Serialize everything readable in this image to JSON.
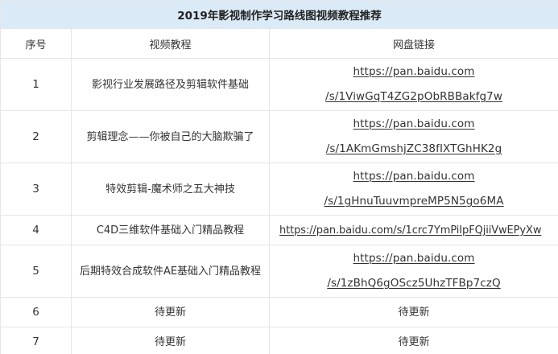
{
  "title": "2019年影视制作学习路线图视频教程推荐",
  "headers": {
    "index": "序号",
    "course": "视频教程",
    "link": "网盘链接"
  },
  "rows": [
    {
      "index": "1",
      "name": "影视行业发展路径及剪辑软件基础",
      "link_line1": "https://pan.baidu.com",
      "link_line2": "/s/1ViwGqT4ZG2pObRBBakfg7w"
    },
    {
      "index": "2",
      "name": "剪辑理念——你被自己的大脑欺骗了",
      "link_line1": "https://pan.baidu.com",
      "link_line2": "/s/1AKmGmshjZC38fIXTGhHK2g"
    },
    {
      "index": "3",
      "name": "特效剪辑-魔术师之五大神技",
      "link_line1": "https://pan.baidu.com",
      "link_line2": "/s/1gHnuTuuvmpreMP5N5go6MA"
    },
    {
      "index": "4",
      "name": "C4D三维软件基础入门精品教程",
      "link_full": "https://pan.baidu.com/s/1crc7YmPiIpFQjiiVwEPyXw"
    },
    {
      "index": "5",
      "name": "后期特效合成软件AE基础入门精品教程",
      "link_line1": "https://pan.baidu.com",
      "link_line2": "/s/1zBhQ6gOScz5UhzTFBp7czQ"
    },
    {
      "index": "6",
      "name": "待更新",
      "link_text": "待更新"
    },
    {
      "index": "7",
      "name": "待更新",
      "link_text": "待更新"
    }
  ]
}
